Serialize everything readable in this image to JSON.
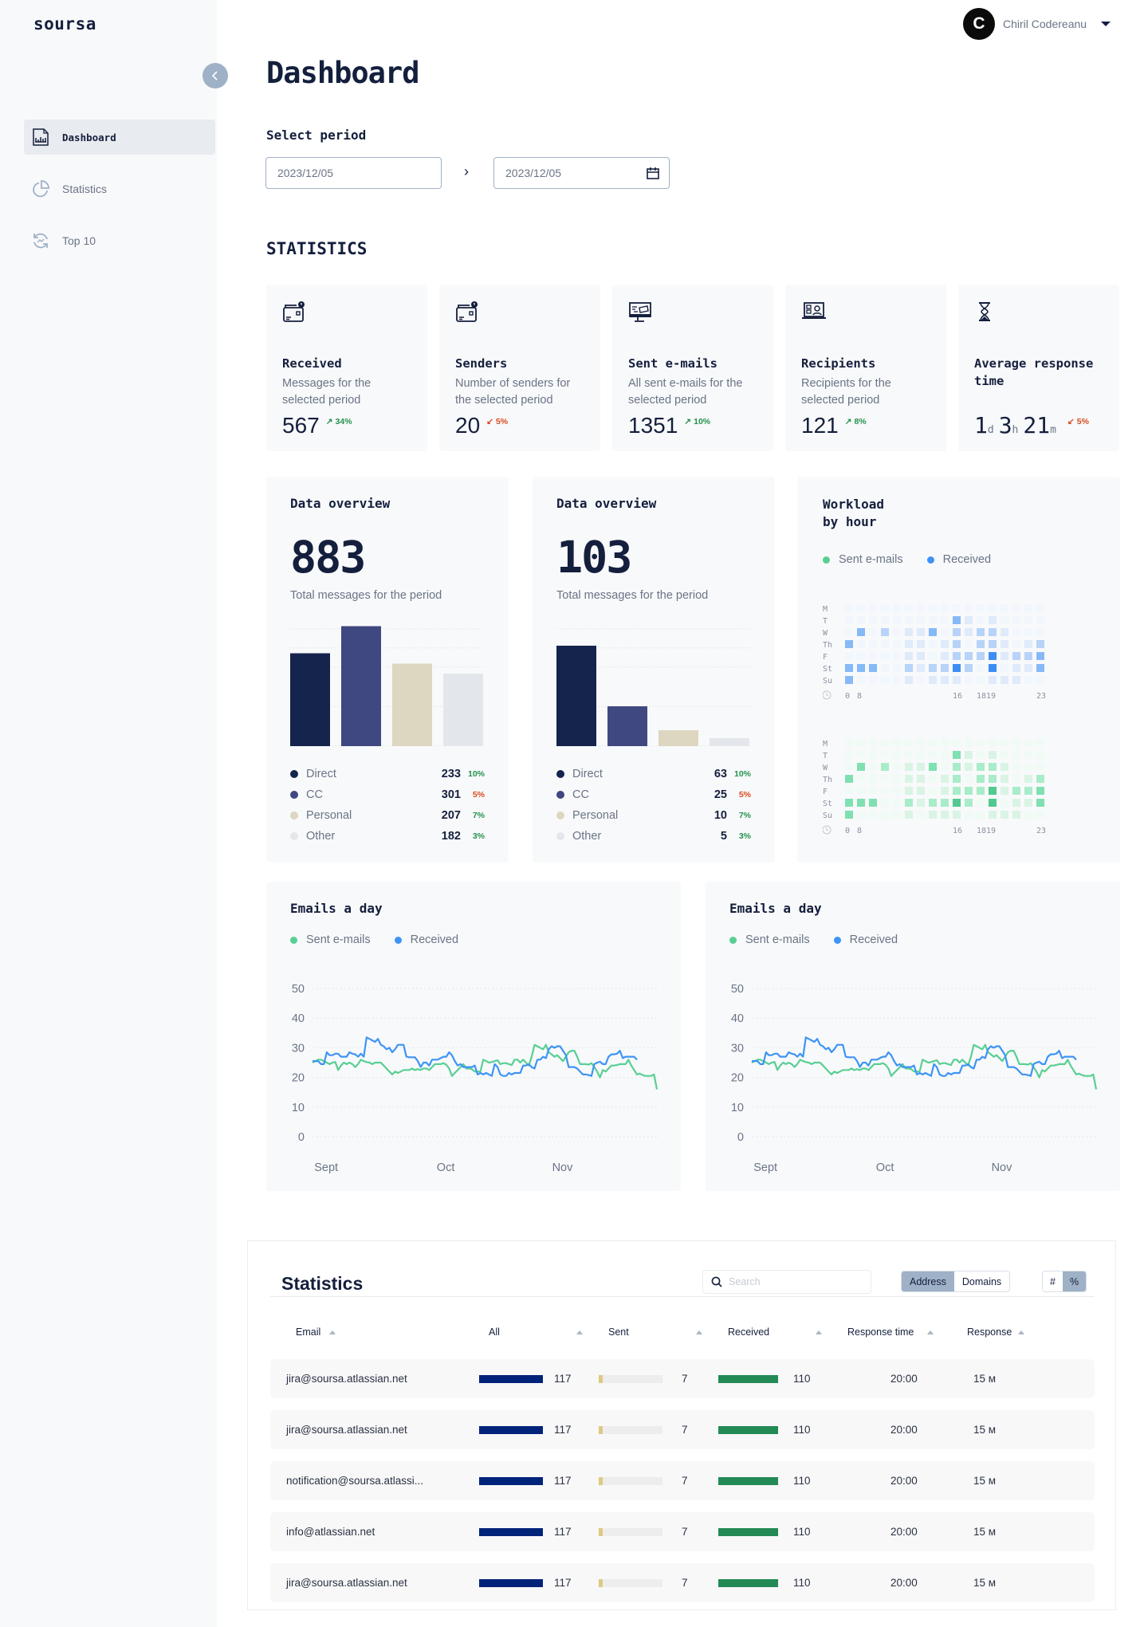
{
  "app": {
    "logo": "soursa",
    "collapse_icon": "chevron-left-icon"
  },
  "sidebar": {
    "items": [
      {
        "label": "Dashboard",
        "icon": "report-chart-icon",
        "active": true
      },
      {
        "label": "Statistics",
        "icon": "pie-chart-icon",
        "active": false
      },
      {
        "label": "Top 10",
        "icon": "refresh-trend-icon",
        "active": false
      }
    ]
  },
  "user": {
    "initial": "C",
    "name": "Chiril Codereanu"
  },
  "page": {
    "title": "Dashboard",
    "period_label": "Select period",
    "date_from": "2023/12/05",
    "date_to": "2023/12/05",
    "arrow": "›",
    "section_title": "STATISTICS"
  },
  "stat_cards": [
    {
      "title": "Received",
      "desc": "Messages for the selected period",
      "value": "567",
      "delta": "34%",
      "trend": "up",
      "icon": "mailbox-alert-icon"
    },
    {
      "title": "Senders",
      "desc": "Number of senders for the selected period",
      "value": "20",
      "delta": "5%",
      "trend": "down",
      "icon": "mailbox-alert-icon"
    },
    {
      "title": "Sent e-mails",
      "desc": "All sent e-mails for the selected period",
      "value": "1351",
      "delta": "10%",
      "trend": "up",
      "icon": "monitor-mail-icon"
    },
    {
      "title": "Recipients",
      "desc": "Recipients for the selected period",
      "value": "121",
      "delta": "8%",
      "trend": "up",
      "icon": "laptop-contact-icon"
    },
    {
      "title": "Average response time",
      "desc": "",
      "value_parts": [
        {
          "n": "1",
          "u": "d"
        },
        {
          "n": "3",
          "u": "h"
        },
        {
          "n": "21",
          "u": "m"
        }
      ],
      "delta": "5%",
      "trend": "down",
      "icon": "hourglass-icon"
    }
  ],
  "trend_arrows": {
    "up": "↗",
    "down": "↙"
  },
  "colors": {
    "direct": "#14244d",
    "cc": "#3f4880",
    "personal": "#ddd6c0",
    "other": "#e3e7eb",
    "sent": "#58cf94",
    "received": "#3d94f5",
    "bar_all": "#00237a",
    "bar_sent": "#dfc981",
    "bar_received": "#238a55",
    "up": "#23924f",
    "down": "#d94a1e"
  },
  "chart_data": [
    {
      "type": "bar",
      "title": "Data overview",
      "total": "883",
      "subtitle": "Total messages for the period",
      "categories": [
        "Direct",
        "CC",
        "Personal",
        "Other"
      ],
      "values": [
        233,
        301,
        207,
        182
      ],
      "deltas": [
        {
          "v": "10%",
          "t": "up"
        },
        {
          "v": "5%",
          "t": "down"
        },
        {
          "v": "7%",
          "t": "up"
        },
        {
          "v": "3%",
          "t": "up"
        }
      ],
      "ylim": [
        0,
        320
      ]
    },
    {
      "type": "bar",
      "title": "Data overview",
      "total": "103",
      "subtitle": "Total messages for the period",
      "categories": [
        "Direct",
        "CC",
        "Personal",
        "Other"
      ],
      "values": [
        63,
        25,
        10,
        5
      ],
      "deltas": [
        {
          "v": "10%",
          "t": "up"
        },
        {
          "v": "5%",
          "t": "down"
        },
        {
          "v": "7%",
          "t": "up"
        },
        {
          "v": "3%",
          "t": "up"
        }
      ],
      "ylim": [
        0,
        80
      ]
    },
    {
      "type": "heatmap",
      "title": "Workload by hour",
      "legend": [
        "Sent e-mails",
        "Received"
      ],
      "rows": [
        "M",
        "T",
        "W",
        "Th",
        "F",
        "St",
        "Su"
      ],
      "x_ticks": [
        {
          "label": "0",
          "col": 0
        },
        {
          "label": "8",
          "col": 1
        },
        {
          "label": "16",
          "col": 9
        },
        {
          "label": "1819",
          "col": 11
        },
        {
          "label": "23",
          "col": 16
        }
      ],
      "columns": 17,
      "intensity_scale": [
        0,
        4
      ],
      "received": [
        [
          0,
          0,
          0,
          0,
          0,
          0,
          0,
          0,
          0,
          0,
          0,
          0,
          0,
          0,
          0,
          0,
          0
        ],
        [
          0,
          0,
          0,
          0,
          0,
          0,
          0,
          0,
          0,
          3,
          1,
          0,
          1,
          0,
          0,
          0,
          0
        ],
        [
          0,
          3,
          0,
          2,
          0,
          1,
          1,
          3,
          0,
          2,
          1,
          2,
          2,
          1,
          0,
          0,
          0
        ],
        [
          3,
          0,
          0,
          0,
          0,
          1,
          1,
          0,
          1,
          2,
          0,
          2,
          2,
          1,
          0,
          1,
          2
        ],
        [
          0,
          0,
          0,
          0,
          0,
          1,
          1,
          0,
          1,
          2,
          2,
          2,
          4,
          1,
          2,
          2,
          3
        ],
        [
          3,
          3,
          3,
          0,
          0,
          2,
          1,
          2,
          2,
          4,
          2,
          0,
          4,
          0,
          1,
          1,
          3
        ],
        [
          3,
          0,
          0,
          0,
          0,
          1,
          0,
          1,
          1,
          1,
          0,
          0,
          1,
          1,
          1,
          0,
          0
        ]
      ],
      "sent": [
        [
          0,
          0,
          0,
          0,
          0,
          0,
          0,
          0,
          0,
          0,
          0,
          0,
          0,
          0,
          0,
          0,
          0
        ],
        [
          0,
          0,
          0,
          0,
          0,
          0,
          0,
          0,
          0,
          3,
          1,
          0,
          1,
          0,
          0,
          0,
          0
        ],
        [
          0,
          3,
          0,
          2,
          0,
          1,
          1,
          3,
          0,
          2,
          1,
          2,
          2,
          1,
          0,
          0,
          0
        ],
        [
          3,
          0,
          0,
          0,
          0,
          1,
          1,
          0,
          1,
          2,
          0,
          2,
          2,
          1,
          0,
          1,
          2
        ],
        [
          0,
          0,
          0,
          0,
          0,
          1,
          1,
          0,
          1,
          2,
          2,
          2,
          4,
          1,
          2,
          2,
          3
        ],
        [
          3,
          3,
          3,
          0,
          0,
          2,
          1,
          2,
          2,
          4,
          2,
          0,
          4,
          0,
          1,
          1,
          3
        ],
        [
          3,
          0,
          0,
          0,
          0,
          1,
          0,
          1,
          1,
          1,
          0,
          0,
          1,
          1,
          1,
          0,
          0
        ]
      ]
    },
    {
      "type": "line",
      "title": "Emails a day",
      "legend": [
        "Sent e-mails",
        "Received"
      ],
      "x_ticks": [
        {
          "label": "Sept",
          "i": 2
        },
        {
          "label": "Oct",
          "i": 44
        },
        {
          "label": "Nov",
          "i": 85
        }
      ],
      "y_ticks": [
        0,
        10,
        20,
        30,
        40,
        50
      ],
      "ylim": [
        0,
        50
      ],
      "series": [
        {
          "name": "Sent e-mails",
          "values": [
            25,
            25.5,
            26,
            26,
            25.5,
            25,
            24.5,
            25,
            25.2,
            22.5,
            24,
            25,
            24.5,
            25,
            24.5,
            23.5,
            24.5,
            26,
            25.5,
            25.2,
            25,
            24.5,
            25,
            25,
            25,
            24,
            23,
            22,
            21,
            22,
            21.5,
            22,
            22.5,
            22.5,
            22.5,
            23,
            22.5,
            22.8,
            22.5,
            23,
            23,
            22.5,
            23.5,
            24.5,
            24.5,
            24.5,
            24.8,
            24.3,
            23,
            20.5,
            21.5,
            22.5,
            23.5,
            24.5,
            23,
            23,
            22.8,
            22,
            22,
            22,
            26,
            25.5,
            25,
            25.2,
            25.5,
            25.8,
            24.5,
            24.8,
            24.8,
            24.5,
            24.2,
            26,
            26,
            25,
            26,
            25,
            24,
            27,
            31,
            30.5,
            30,
            29.5,
            31,
            28.5,
            27.8,
            27,
            27.5,
            26.5,
            25.5,
            27,
            28.5,
            29,
            29,
            27,
            24.5,
            24.5,
            24.5,
            24.3,
            24.8,
            23.5,
            22,
            20,
            22.5,
            22,
            23,
            24,
            24,
            24.2,
            24.5,
            24.5,
            24.5,
            26,
            24,
            22.5,
            21,
            21.3,
            20.8,
            20.5,
            20.5,
            20.5,
            21,
            16
          ]
        },
        {
          "name": "Received",
          "values": [
            25.5,
            25.5,
            25.5,
            24.5,
            24.5,
            28.5,
            27.5,
            27.5,
            28,
            28,
            27,
            27,
            27,
            28.5,
            28,
            27.8,
            27,
            28,
            27,
            33.5,
            33,
            32.5,
            32,
            33,
            31,
            30.5,
            29.5,
            30,
            28.5,
            29.5,
            31,
            31,
            31,
            27,
            26.8,
            26.8,
            26.8,
            25.5,
            23.5,
            25,
            25,
            24,
            26,
            26,
            26,
            26.5,
            27,
            27,
            28.5,
            27.5,
            25.5,
            24,
            24.5,
            23.5,
            23.5,
            23.5,
            23.5,
            24,
            21,
            21.5,
            21,
            21.5,
            21,
            20.5,
            24.5,
            23.5,
            21,
            20.5,
            20.5,
            21.5,
            21,
            21.5,
            21.5,
            21.5,
            24,
            24,
            24.5,
            23.5,
            23,
            26,
            26,
            27,
            26.5,
            29.5,
            30.5,
            30,
            30.5,
            30.5,
            29,
            27.5,
            23.5,
            23.5,
            23.5,
            23,
            22,
            21,
            21,
            20.8,
            20.5,
            24.5,
            25,
            25.3,
            24.5,
            24.5,
            27,
            27.8,
            27.8,
            28,
            29,
            26.5,
            27,
            27,
            27,
            27,
            26
          ]
        }
      ]
    }
  ],
  "table": {
    "title": "Statistics",
    "search_placeholder": "Search",
    "view_options": [
      {
        "label": "Address",
        "on": true
      },
      {
        "label": "Domains",
        "on": false
      }
    ],
    "unit_options": [
      {
        "label": "#",
        "on": false
      },
      {
        "label": "%",
        "on": true
      }
    ],
    "columns": [
      "Email",
      "All",
      "Sent",
      "Received",
      "Response time",
      "Response"
    ],
    "max": {
      "all": 117,
      "sent": 117,
      "received": 117
    },
    "rows": [
      {
        "email": "jira@soursa.atlassian.net",
        "all": 117,
        "sent": 7,
        "received": 110,
        "response_time": "20:00",
        "response": "15 м"
      },
      {
        "email": "jira@soursa.atlassian.net",
        "all": 117,
        "sent": 7,
        "received": 110,
        "response_time": "20:00",
        "response": "15 м"
      },
      {
        "email": "notification@soursa.atlassi...",
        "all": 117,
        "sent": 7,
        "received": 110,
        "response_time": "20:00",
        "response": "15 м"
      },
      {
        "email": "info@atlassian.net",
        "all": 117,
        "sent": 7,
        "received": 110,
        "response_time": "20:00",
        "response": "15 м"
      },
      {
        "email": "jira@soursa.atlassian.net",
        "all": 117,
        "sent": 7,
        "received": 110,
        "response_time": "20:00",
        "response": "15 м"
      }
    ]
  }
}
